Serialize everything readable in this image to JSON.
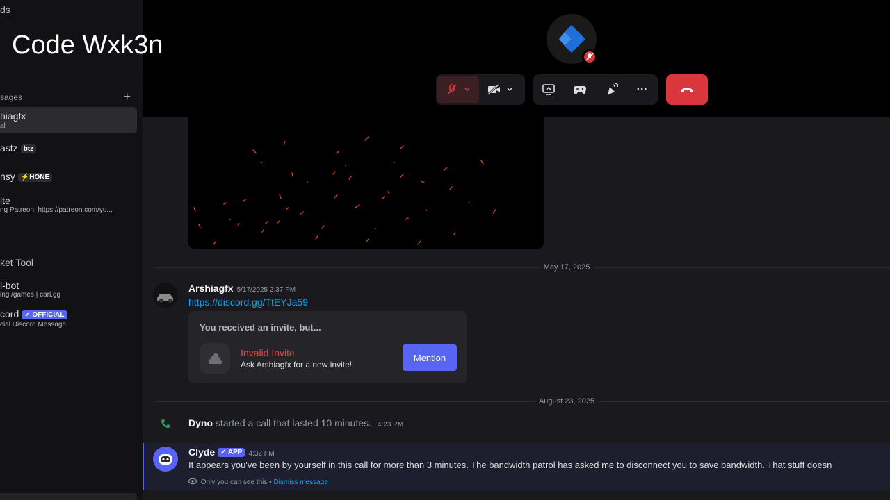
{
  "overlay": {
    "code_text": "Code Wxk3n"
  },
  "sidebar": {
    "top_text": "ds",
    "dm_heading": "sages",
    "add_dm_symbol": "+",
    "dms": [
      {
        "name": "hiagfx",
        "sub": "al"
      },
      {
        "name": "astz",
        "tag": "btz"
      },
      {
        "name": "nsy",
        "tag": "⚡HONE"
      },
      {
        "name": "ite",
        "sub": "ng Patreon: https://patreon.com/yu..."
      }
    ],
    "section_label": "ket Tool",
    "apps": [
      {
        "name": "l-bot",
        "sub": "ing /games | carl.gg"
      },
      {
        "name": "cord",
        "tag": "✓ OFFICIAL",
        "sub": "cial Discord Message"
      }
    ]
  },
  "call": {
    "controls": [
      "mic-muted",
      "camera-off",
      "screen-share",
      "activities",
      "soundboard",
      "more"
    ],
    "more_symbol": "···",
    "colors": {
      "hangup": "#da373c",
      "mute": "#da373c"
    }
  },
  "messages": {
    "date1": "May 17, 2025",
    "msg1": {
      "author": "Arshiagfx",
      "time": "5/17/2025 2:37 PM",
      "link": "https://discord.gg/TtEYJa59",
      "invite": {
        "title": "You received an invite, but...",
        "name": "Invalid Invite",
        "sub": "Ask Arshiagfx for a new invite!",
        "button": "Mention"
      }
    },
    "date2": "August 23, 2025",
    "call_log": {
      "author": "Dyno",
      "text": "started a call that lasted 10 minutes.",
      "time": "4:23 PM"
    },
    "clyde": {
      "author": "Clyde",
      "tag": "✓ APP",
      "time": "4:32 PM",
      "text": "It appears you've been by yourself in this call for more than 3 minutes. The bandwidth patrol has asked me to disconnect you to save bandwidth. That stuff doesn",
      "note": "Only you can see this •",
      "dismiss": "Dismiss message"
    }
  }
}
